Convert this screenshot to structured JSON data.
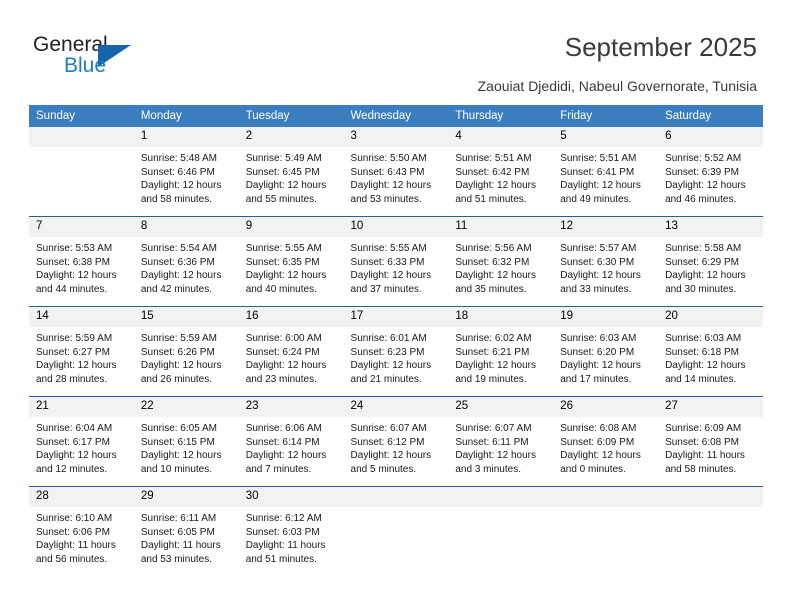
{
  "brand": {
    "name_top": "General",
    "name_bottom": "Blue",
    "accent_color": "#1565a8",
    "text_color": "#1c7fc4"
  },
  "header": {
    "title": "September 2025",
    "subtitle": "Zaouiat Djedidi, Nabeul Governorate, Tunisia",
    "header_bg": "#3b7ec0"
  },
  "calendar": {
    "weekday_headers": [
      "Sunday",
      "Monday",
      "Tuesday",
      "Wednesday",
      "Thursday",
      "Friday",
      "Saturday"
    ],
    "labels": {
      "sunrise": "Sunrise:",
      "sunset": "Sunset:",
      "daylight": "Daylight:"
    },
    "weeks": [
      [
        {
          "day": "",
          "sunrise": "",
          "sunset": "",
          "daylight1": "",
          "daylight2": "",
          "empty": true
        },
        {
          "day": "1",
          "sunrise": "Sunrise: 5:48 AM",
          "sunset": "Sunset: 6:46 PM",
          "daylight1": "Daylight: 12 hours",
          "daylight2": "and 58 minutes."
        },
        {
          "day": "2",
          "sunrise": "Sunrise: 5:49 AM",
          "sunset": "Sunset: 6:45 PM",
          "daylight1": "Daylight: 12 hours",
          "daylight2": "and 55 minutes."
        },
        {
          "day": "3",
          "sunrise": "Sunrise: 5:50 AM",
          "sunset": "Sunset: 6:43 PM",
          "daylight1": "Daylight: 12 hours",
          "daylight2": "and 53 minutes."
        },
        {
          "day": "4",
          "sunrise": "Sunrise: 5:51 AM",
          "sunset": "Sunset: 6:42 PM",
          "daylight1": "Daylight: 12 hours",
          "daylight2": "and 51 minutes."
        },
        {
          "day": "5",
          "sunrise": "Sunrise: 5:51 AM",
          "sunset": "Sunset: 6:41 PM",
          "daylight1": "Daylight: 12 hours",
          "daylight2": "and 49 minutes."
        },
        {
          "day": "6",
          "sunrise": "Sunrise: 5:52 AM",
          "sunset": "Sunset: 6:39 PM",
          "daylight1": "Daylight: 12 hours",
          "daylight2": "and 46 minutes."
        }
      ],
      [
        {
          "day": "7",
          "sunrise": "Sunrise: 5:53 AM",
          "sunset": "Sunset: 6:38 PM",
          "daylight1": "Daylight: 12 hours",
          "daylight2": "and 44 minutes."
        },
        {
          "day": "8",
          "sunrise": "Sunrise: 5:54 AM",
          "sunset": "Sunset: 6:36 PM",
          "daylight1": "Daylight: 12 hours",
          "daylight2": "and 42 minutes."
        },
        {
          "day": "9",
          "sunrise": "Sunrise: 5:55 AM",
          "sunset": "Sunset: 6:35 PM",
          "daylight1": "Daylight: 12 hours",
          "daylight2": "and 40 minutes."
        },
        {
          "day": "10",
          "sunrise": "Sunrise: 5:55 AM",
          "sunset": "Sunset: 6:33 PM",
          "daylight1": "Daylight: 12 hours",
          "daylight2": "and 37 minutes."
        },
        {
          "day": "11",
          "sunrise": "Sunrise: 5:56 AM",
          "sunset": "Sunset: 6:32 PM",
          "daylight1": "Daylight: 12 hours",
          "daylight2": "and 35 minutes."
        },
        {
          "day": "12",
          "sunrise": "Sunrise: 5:57 AM",
          "sunset": "Sunset: 6:30 PM",
          "daylight1": "Daylight: 12 hours",
          "daylight2": "and 33 minutes."
        },
        {
          "day": "13",
          "sunrise": "Sunrise: 5:58 AM",
          "sunset": "Sunset: 6:29 PM",
          "daylight1": "Daylight: 12 hours",
          "daylight2": "and 30 minutes."
        }
      ],
      [
        {
          "day": "14",
          "sunrise": "Sunrise: 5:59 AM",
          "sunset": "Sunset: 6:27 PM",
          "daylight1": "Daylight: 12 hours",
          "daylight2": "and 28 minutes."
        },
        {
          "day": "15",
          "sunrise": "Sunrise: 5:59 AM",
          "sunset": "Sunset: 6:26 PM",
          "daylight1": "Daylight: 12 hours",
          "daylight2": "and 26 minutes."
        },
        {
          "day": "16",
          "sunrise": "Sunrise: 6:00 AM",
          "sunset": "Sunset: 6:24 PM",
          "daylight1": "Daylight: 12 hours",
          "daylight2": "and 23 minutes."
        },
        {
          "day": "17",
          "sunrise": "Sunrise: 6:01 AM",
          "sunset": "Sunset: 6:23 PM",
          "daylight1": "Daylight: 12 hours",
          "daylight2": "and 21 minutes."
        },
        {
          "day": "18",
          "sunrise": "Sunrise: 6:02 AM",
          "sunset": "Sunset: 6:21 PM",
          "daylight1": "Daylight: 12 hours",
          "daylight2": "and 19 minutes."
        },
        {
          "day": "19",
          "sunrise": "Sunrise: 6:03 AM",
          "sunset": "Sunset: 6:20 PM",
          "daylight1": "Daylight: 12 hours",
          "daylight2": "and 17 minutes."
        },
        {
          "day": "20",
          "sunrise": "Sunrise: 6:03 AM",
          "sunset": "Sunset: 6:18 PM",
          "daylight1": "Daylight: 12 hours",
          "daylight2": "and 14 minutes."
        }
      ],
      [
        {
          "day": "21",
          "sunrise": "Sunrise: 6:04 AM",
          "sunset": "Sunset: 6:17 PM",
          "daylight1": "Daylight: 12 hours",
          "daylight2": "and 12 minutes."
        },
        {
          "day": "22",
          "sunrise": "Sunrise: 6:05 AM",
          "sunset": "Sunset: 6:15 PM",
          "daylight1": "Daylight: 12 hours",
          "daylight2": "and 10 minutes."
        },
        {
          "day": "23",
          "sunrise": "Sunrise: 6:06 AM",
          "sunset": "Sunset: 6:14 PM",
          "daylight1": "Daylight: 12 hours",
          "daylight2": "and 7 minutes."
        },
        {
          "day": "24",
          "sunrise": "Sunrise: 6:07 AM",
          "sunset": "Sunset: 6:12 PM",
          "daylight1": "Daylight: 12 hours",
          "daylight2": "and 5 minutes."
        },
        {
          "day": "25",
          "sunrise": "Sunrise: 6:07 AM",
          "sunset": "Sunset: 6:11 PM",
          "daylight1": "Daylight: 12 hours",
          "daylight2": "and 3 minutes."
        },
        {
          "day": "26",
          "sunrise": "Sunrise: 6:08 AM",
          "sunset": "Sunset: 6:09 PM",
          "daylight1": "Daylight: 12 hours",
          "daylight2": "and 0 minutes."
        },
        {
          "day": "27",
          "sunrise": "Sunrise: 6:09 AM",
          "sunset": "Sunset: 6:08 PM",
          "daylight1": "Daylight: 11 hours",
          "daylight2": "and 58 minutes."
        }
      ],
      [
        {
          "day": "28",
          "sunrise": "Sunrise: 6:10 AM",
          "sunset": "Sunset: 6:06 PM",
          "daylight1": "Daylight: 11 hours",
          "daylight2": "and 56 minutes."
        },
        {
          "day": "29",
          "sunrise": "Sunrise: 6:11 AM",
          "sunset": "Sunset: 6:05 PM",
          "daylight1": "Daylight: 11 hours",
          "daylight2": "and 53 minutes."
        },
        {
          "day": "30",
          "sunrise": "Sunrise: 6:12 AM",
          "sunset": "Sunset: 6:03 PM",
          "daylight1": "Daylight: 11 hours",
          "daylight2": "and 51 minutes."
        },
        {
          "day": "",
          "sunrise": "",
          "sunset": "",
          "daylight1": "",
          "daylight2": "",
          "empty": true
        },
        {
          "day": "",
          "sunrise": "",
          "sunset": "",
          "daylight1": "",
          "daylight2": "",
          "empty": true
        },
        {
          "day": "",
          "sunrise": "",
          "sunset": "",
          "daylight1": "",
          "daylight2": "",
          "empty": true
        },
        {
          "day": "",
          "sunrise": "",
          "sunset": "",
          "daylight1": "",
          "daylight2": "",
          "empty": true
        }
      ]
    ]
  }
}
